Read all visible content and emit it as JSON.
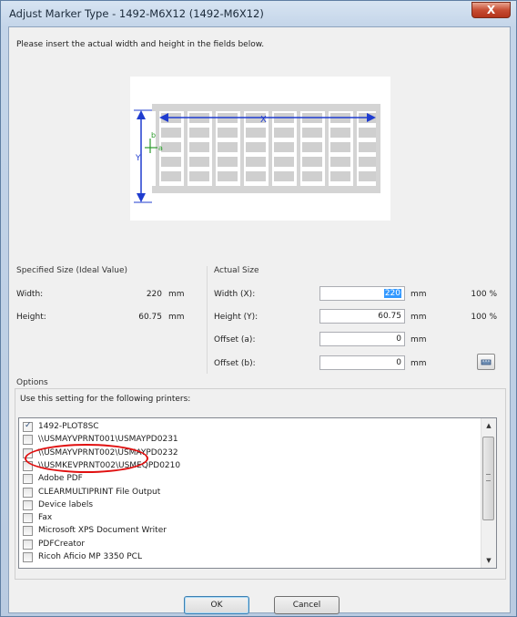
{
  "window": {
    "title": "Adjust Marker Type - 1492-M6X12 (1492-M6X12)",
    "close_label": "X",
    "instruction": "Please insert the actual width and height in the fields below."
  },
  "diagram": {
    "label_x": "X",
    "label_y": "Y",
    "label_a": "a",
    "label_b": "b"
  },
  "specified": {
    "group_label": "Specified Size (Ideal Value)",
    "width_label": "Width:",
    "width_value": "220",
    "width_unit": "mm",
    "height_label": "Height:",
    "height_value": "60.75",
    "height_unit": "mm"
  },
  "actual": {
    "group_label": "Actual Size",
    "width_label": "Width (X):",
    "width_value": "220",
    "width_unit": "mm",
    "width_pct": "100 %",
    "height_label": "Height (Y):",
    "height_value": "60.75",
    "height_unit": "mm",
    "height_pct": "100 %",
    "offset_a_label": "Offset (a):",
    "offset_a_value": "0",
    "offset_a_unit": "mm",
    "offset_b_label": "Offset (b):",
    "offset_b_value": "0",
    "offset_b_unit": "mm"
  },
  "options": {
    "group_label": "Options",
    "printers_label": "Use this setting for the following printers:",
    "printers": [
      {
        "name": "1492-PLOT8SC",
        "checked": true
      },
      {
        "name": "\\\\USMAYVPRNT001\\USMAYPD0231",
        "checked": false
      },
      {
        "name": "\\\\USMAYVPRNT002\\USMAYPD0232",
        "checked": false
      },
      {
        "name": "\\\\USMKEVPRNT002\\USMEQPD0210",
        "checked": false
      },
      {
        "name": "Adobe PDF",
        "checked": false
      },
      {
        "name": "CLEARMULTIPRINT File Output",
        "checked": false
      },
      {
        "name": "Device labels",
        "checked": false
      },
      {
        "name": "Fax",
        "checked": false
      },
      {
        "name": "Microsoft XPS Document Writer",
        "checked": false
      },
      {
        "name": "PDFCreator",
        "checked": false
      },
      {
        "name": "Ricoh Aficio MP 3350 PCL",
        "checked": false
      }
    ]
  },
  "buttons": {
    "ok": "OK",
    "cancel": "Cancel"
  },
  "colors": {
    "annotation": "#e01010",
    "selection": "#3399ff",
    "diagram_arrow": "#1f3ccf",
    "diagram_offset": "#2a9a2a"
  }
}
